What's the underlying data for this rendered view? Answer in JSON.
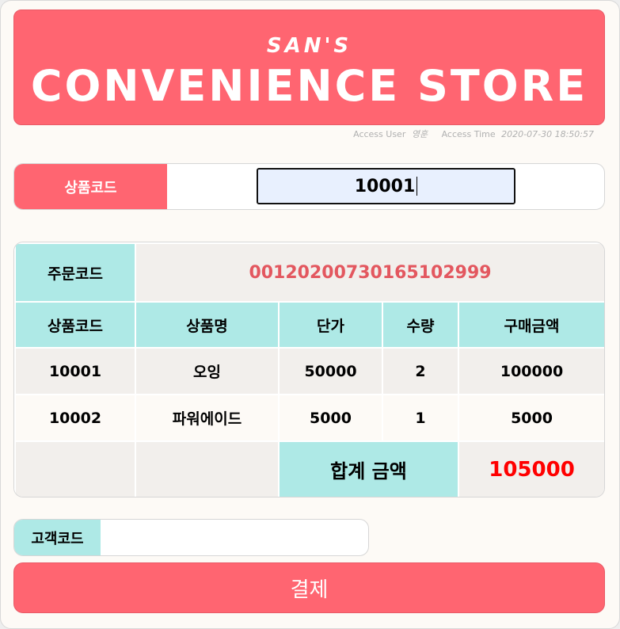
{
  "header": {
    "subtitle": "SAN'S",
    "title": "CONVENIENCE STORE"
  },
  "access": {
    "user_label": "Access User",
    "user_value": "영훈",
    "time_label": "Access Time",
    "time_value": "2020-07-30 18:50:57"
  },
  "product_code": {
    "label": "상품코드",
    "value": "10001"
  },
  "order": {
    "code_label": "주문코드",
    "code_value": "00120200730165102999",
    "columns": [
      "상품코드",
      "상품명",
      "단가",
      "수량",
      "구매금액"
    ],
    "rows": [
      {
        "code": "10001",
        "name": "오잉",
        "price": "50000",
        "qty": "2",
        "amount": "100000"
      },
      {
        "code": "10002",
        "name": "파워에이드",
        "price": "5000",
        "qty": "1",
        "amount": "5000"
      }
    ],
    "total_label": "합계 금액",
    "total_value": "105000"
  },
  "customer": {
    "label": "고객코드",
    "value": ""
  },
  "pay_button": "결제",
  "colors": {
    "accent": "#ff6571",
    "teal": "#aee9e6",
    "total": "#ff0000"
  }
}
